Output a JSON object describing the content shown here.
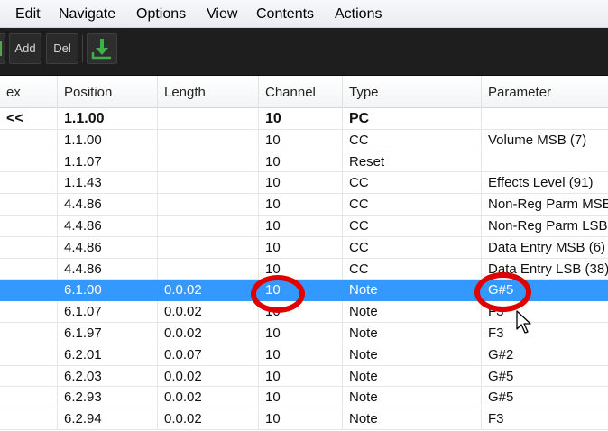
{
  "menu": [
    "Edit",
    "Navigate",
    "Options",
    "View",
    "Contents",
    "Actions"
  ],
  "toolbar": {
    "add_label": "Add",
    "del_label": "Del",
    "insert_icon": "insert-down-arrow-icon"
  },
  "columns": [
    "ex",
    "Position",
    "Length",
    "Channel",
    "Type",
    "Parameter"
  ],
  "rows": [
    {
      "index": "<<",
      "position": "1.1.00",
      "length": "",
      "channel": "10",
      "type": "PC",
      "parameter": "",
      "bold": true
    },
    {
      "index": "",
      "position": "1.1.00",
      "length": "",
      "channel": "10",
      "type": "CC",
      "parameter": "Volume MSB (7)"
    },
    {
      "index": "",
      "position": "1.1.07",
      "length": "",
      "channel": "10",
      "type": "Reset",
      "parameter": ""
    },
    {
      "index": "",
      "position": "1.1.43",
      "length": "",
      "channel": "10",
      "type": "CC",
      "parameter": "Effects Level (91)"
    },
    {
      "index": "",
      "position": "4.4.86",
      "length": "",
      "channel": "10",
      "type": "CC",
      "parameter": "Non-Reg Parm MSB"
    },
    {
      "index": "",
      "position": "4.4.86",
      "length": "",
      "channel": "10",
      "type": "CC",
      "parameter": "Non-Reg Parm LSB"
    },
    {
      "index": "",
      "position": "4.4.86",
      "length": "",
      "channel": "10",
      "type": "CC",
      "parameter": "Data Entry MSB (6)"
    },
    {
      "index": "",
      "position": "4.4.86",
      "length": "",
      "channel": "10",
      "type": "CC",
      "parameter": "Data Entry LSB (38)"
    },
    {
      "index": "",
      "position": "6.1.00",
      "length": "0.0.02",
      "channel": "10",
      "type": "Note",
      "parameter": "G#5",
      "selected": true
    },
    {
      "index": "",
      "position": "6.1.07",
      "length": "0.0.02",
      "channel": "10",
      "type": "Note",
      "parameter": "F3"
    },
    {
      "index": "",
      "position": "6.1.97",
      "length": "0.0.02",
      "channel": "10",
      "type": "Note",
      "parameter": "F3"
    },
    {
      "index": "",
      "position": "6.2.01",
      "length": "0.0.07",
      "channel": "10",
      "type": "Note",
      "parameter": "G#2"
    },
    {
      "index": "",
      "position": "6.2.03",
      "length": "0.0.02",
      "channel": "10",
      "type": "Note",
      "parameter": "G#5"
    },
    {
      "index": "",
      "position": "6.2.93",
      "length": "0.0.02",
      "channel": "10",
      "type": "Note",
      "parameter": "G#5"
    },
    {
      "index": "",
      "position": "6.2.94",
      "length": "0.0.02",
      "channel": "10",
      "type": "Note",
      "parameter": "F3"
    }
  ],
  "colors": {
    "selection": "#3399ff",
    "annotation_ring": "#e00000",
    "toolbar": "#1e1e1e"
  }
}
